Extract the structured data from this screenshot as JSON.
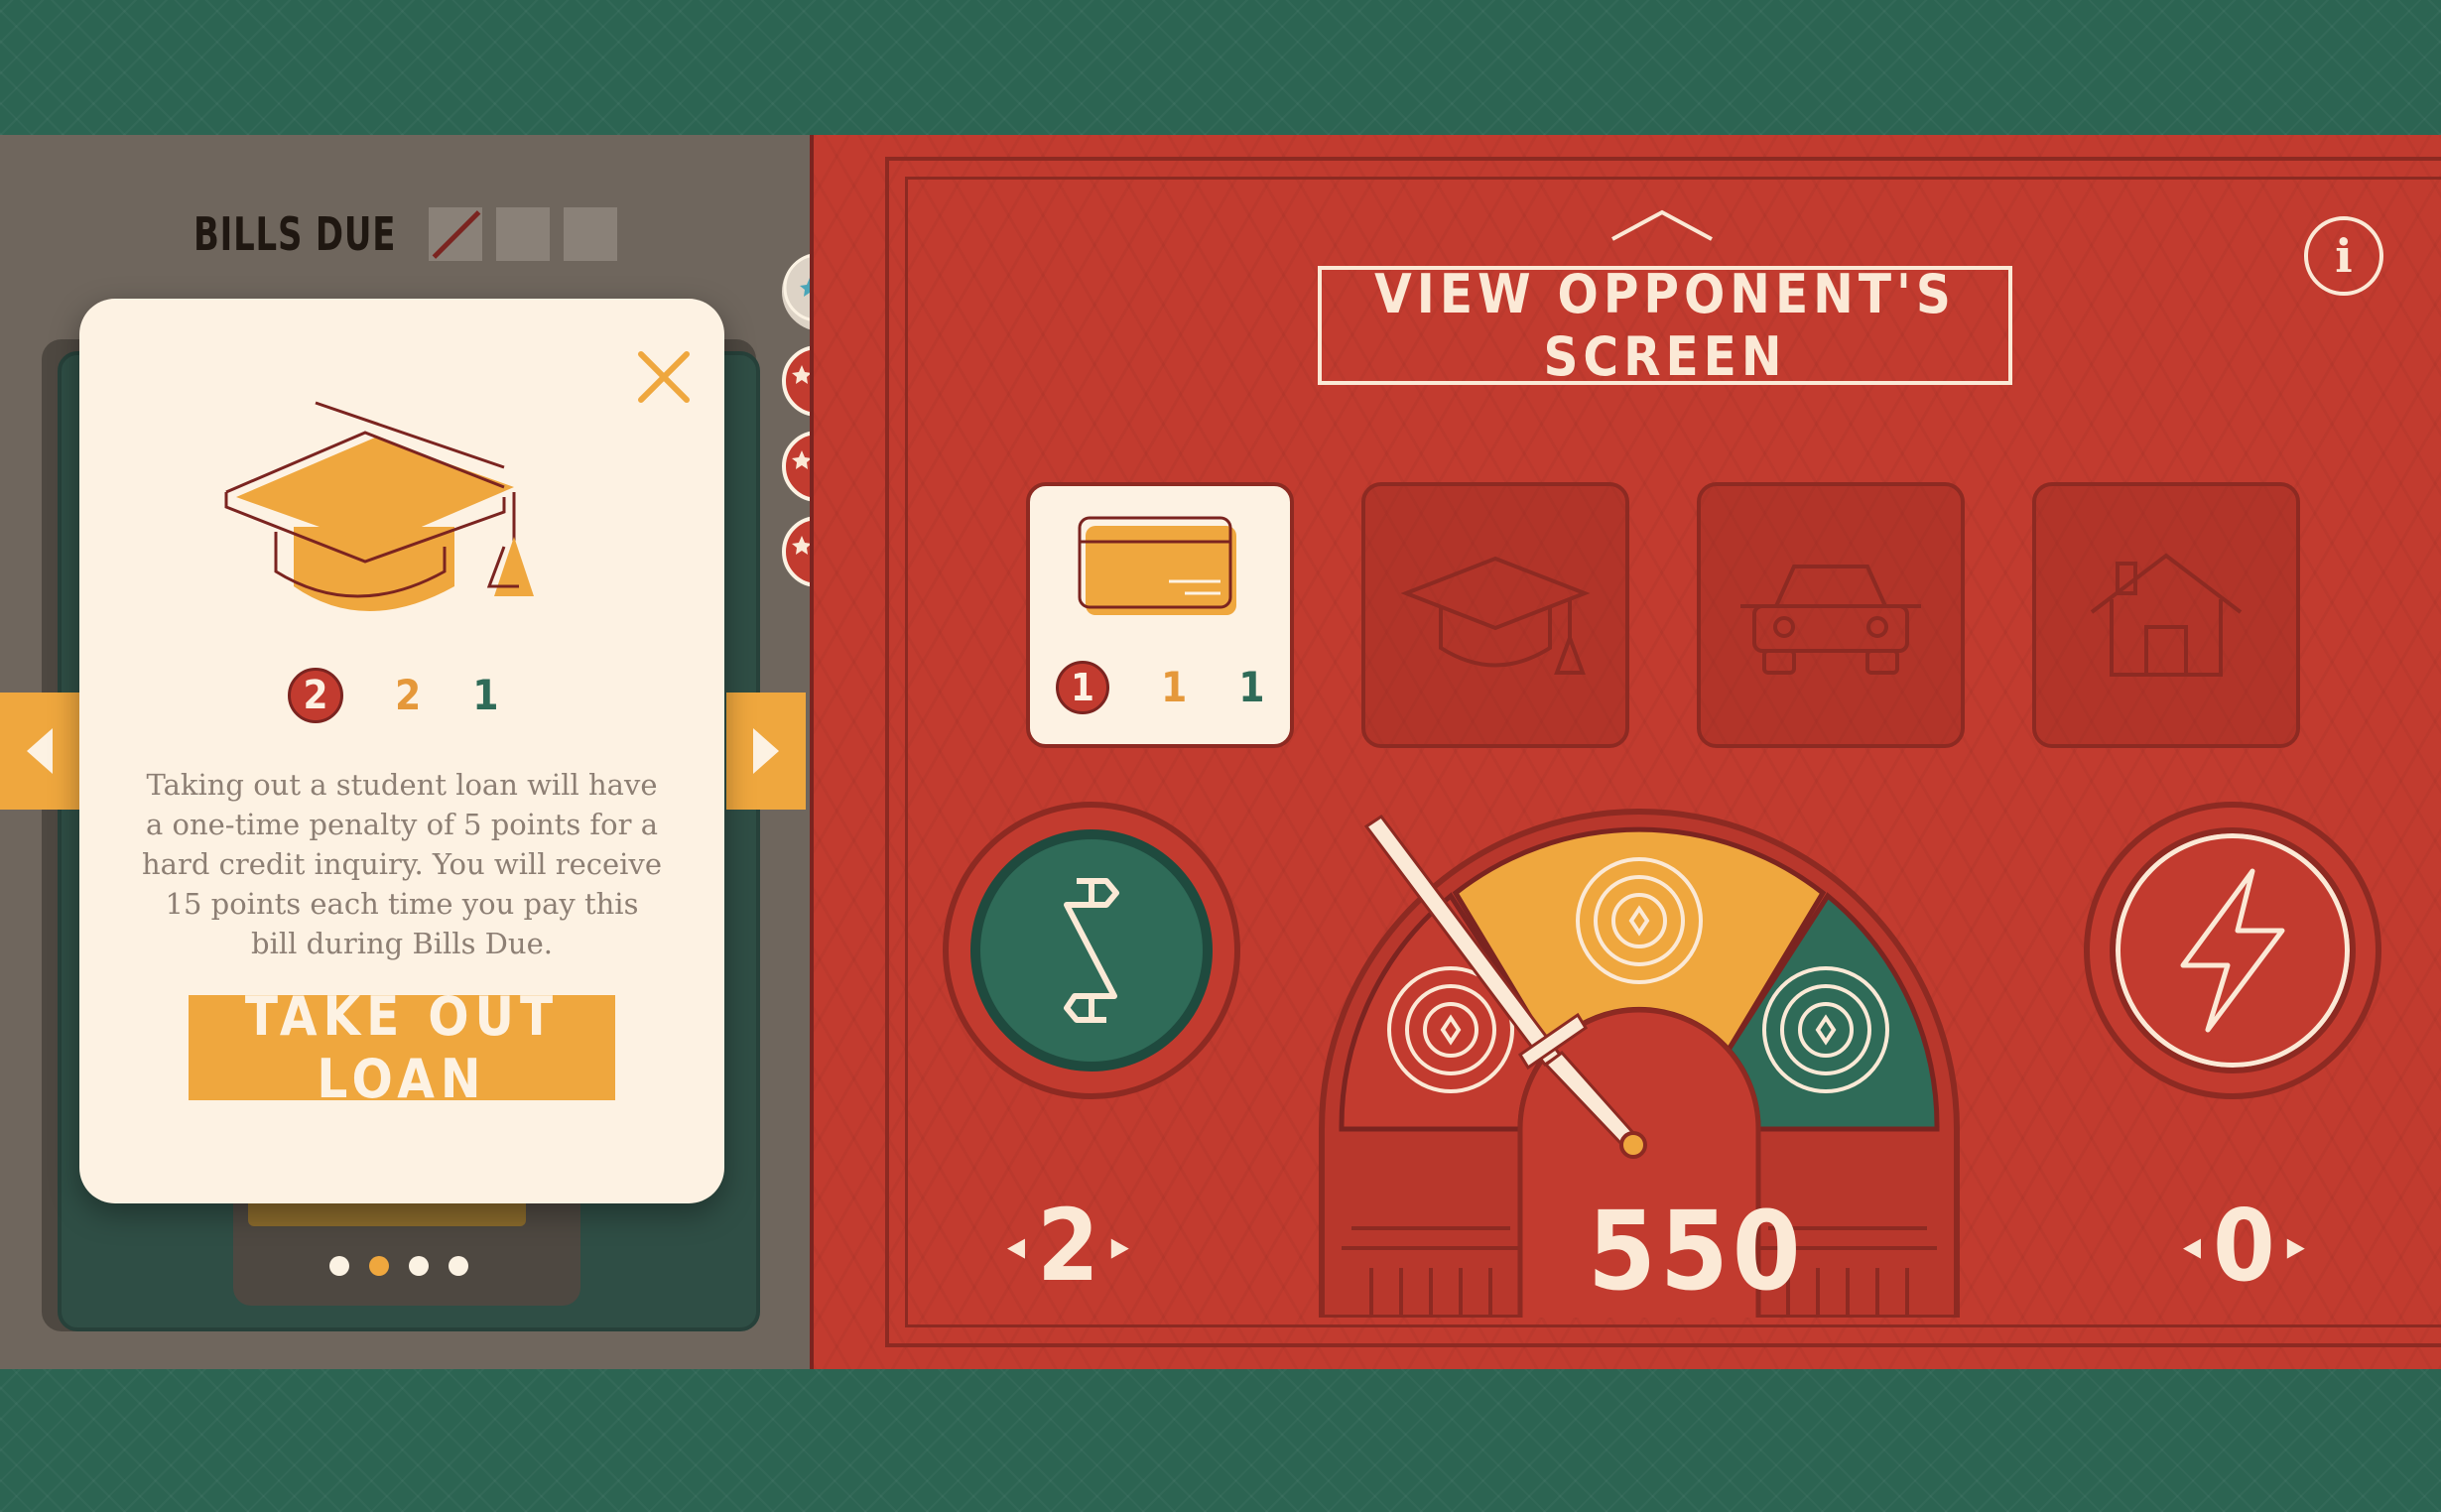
{
  "bills_due": {
    "label": "BILLS DUE",
    "boxes": [
      "paid",
      "empty",
      "empty"
    ]
  },
  "loan_card": {
    "stats": {
      "red": "2",
      "yellow": "2",
      "green": "1"
    },
    "description": "Taking out a student loan will have a one-time penalty of 5 points for a hard credit inquiry. You will receive 15 points each time you pay this bill during Bills Due.",
    "button_label": "TAKE OUT LOAN",
    "icon": "graduation-cap-icon"
  },
  "deck": {
    "page_dots": [
      "inactive",
      "active",
      "inactive",
      "inactive"
    ]
  },
  "header": {
    "view_opponent_label": "VIEW OPPONENT'S SCREEN",
    "info_label": "i"
  },
  "bills": [
    {
      "name": "credit-card",
      "icon": "credit-card-icon",
      "stats": {
        "red": "1",
        "yellow": "1",
        "green": "1"
      },
      "active": true
    },
    {
      "name": "student-loan",
      "icon": "graduation-cap-icon",
      "active": false
    },
    {
      "name": "car-loan",
      "icon": "car-icon",
      "active": false
    },
    {
      "name": "mortgage",
      "icon": "house-icon",
      "active": false
    }
  ],
  "counters": {
    "money": "2",
    "score": "550",
    "power": "0"
  },
  "colors": {
    "red": "#c23b2f",
    "dark_red": "#8d2a22",
    "yellow": "#efa73e",
    "green": "#2f6b58",
    "cream": "#fdf2e3",
    "slate": "#6f665d"
  }
}
